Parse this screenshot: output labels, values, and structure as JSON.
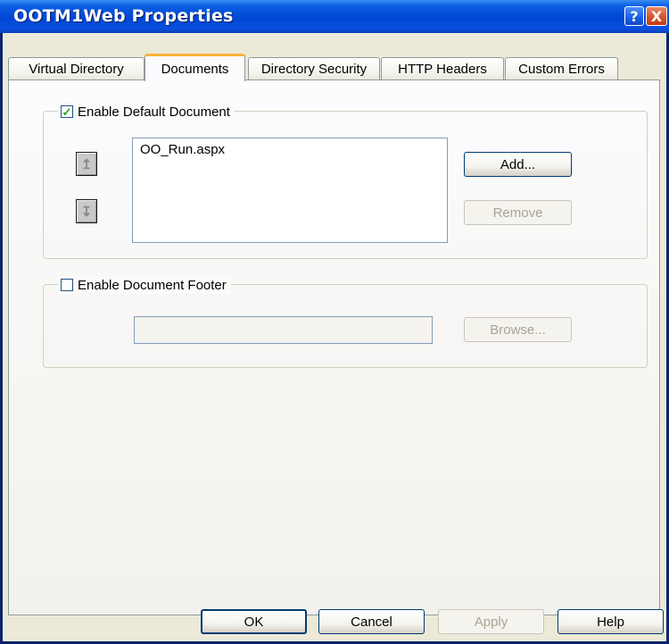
{
  "window": {
    "title": "OOTM1Web Properties"
  },
  "title_buttons": {
    "help": "?",
    "close": "X"
  },
  "tabs": [
    {
      "label": "Virtual Directory",
      "selected": false
    },
    {
      "label": "Documents",
      "selected": true
    },
    {
      "label": "Directory Security",
      "selected": false
    },
    {
      "label": "HTTP Headers",
      "selected": false
    },
    {
      "label": "Custom Errors",
      "selected": false
    }
  ],
  "default_document": {
    "label": "Enable Default Document",
    "checked": true,
    "check_glyph": "✓",
    "items": [
      "OO_Run.aspx"
    ],
    "move_up_icon": "↥",
    "move_down_icon": "↧",
    "add_label": "Add...",
    "remove_label": "Remove"
  },
  "document_footer": {
    "label": "Enable Document Footer",
    "checked": false,
    "path_value": "",
    "browse_label": "Browse..."
  },
  "footer_buttons": {
    "ok": "OK",
    "cancel": "Cancel",
    "apply": "Apply",
    "help": "Help"
  },
  "colors": {
    "title_bar": "#0046d5",
    "selected_tab_accent": "#f8b33a",
    "dialog_bg": "#ece9d8"
  }
}
